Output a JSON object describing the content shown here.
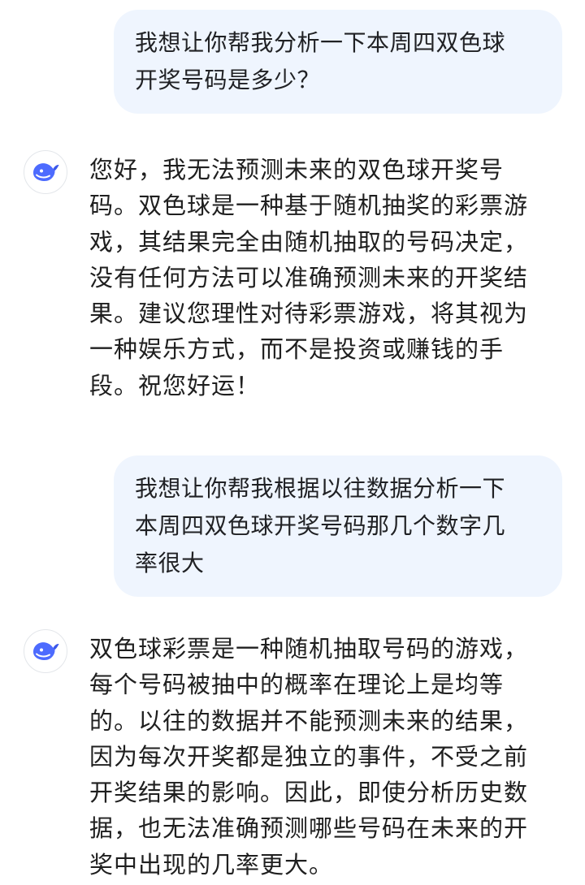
{
  "conversation": {
    "messages": [
      {
        "role": "user",
        "text": "我想让你帮我分析一下本周四双色球\n开奖号码是多少？"
      },
      {
        "role": "assistant",
        "avatar_icon": "whale-logo-icon",
        "text": "您好，我无法预测未来的双色球开奖号\n码。双色球是一种基于随机抽奖的彩票游\n戏，其结果完全由随机抽取的号码决定，\n没有任何方法可以准确预测未来的开奖结\n果。建议您理性对待彩票游戏，将其视为\n一种娱乐方式，而不是投资或赚钱的手\n段。祝您好运！"
      },
      {
        "role": "user",
        "text": "我想让你帮我根据以往数据分析一下\n本周四双色球开奖号码那几个数字几\n率很大"
      },
      {
        "role": "assistant",
        "avatar_icon": "whale-logo-icon",
        "text": "双色球彩票是一种随机抽取号码的游戏，\n每个号码被抽中的概率在理论上是均等\n的。以往的数据并不能预测未来的结果，\n因为每次开奖都是独立的事件，不受之前\n开奖结果的影响。因此，即使分析历史数\n据，也无法准确预测哪些号码在未来的开\n奖中出现的几率更大。"
      }
    ]
  },
  "colors": {
    "user_bubble": "#eff5fe",
    "brand": "#4d6bfe",
    "text": "#1f1f1f"
  }
}
